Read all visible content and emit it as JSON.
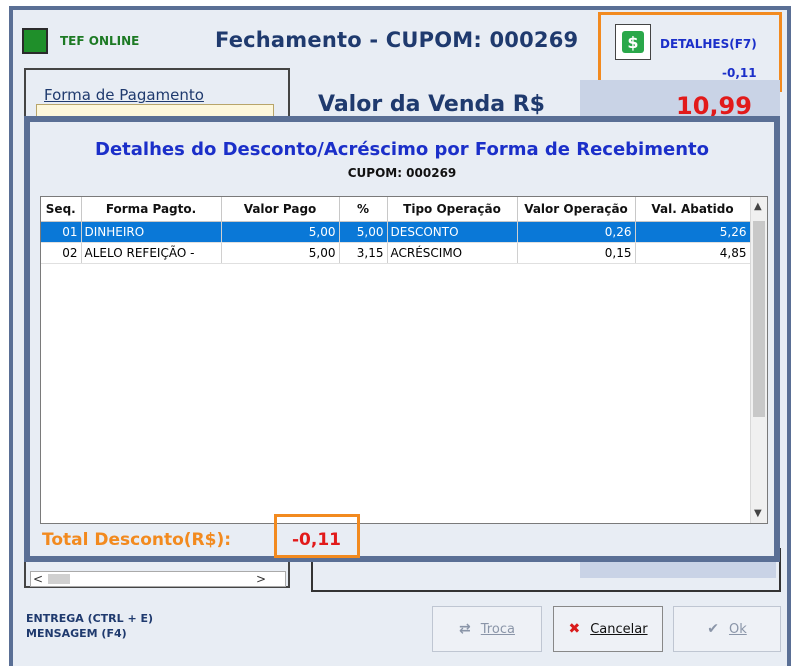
{
  "header": {
    "tef_label": "TEF ONLINE",
    "title": "Fechamento - CUPOM: 000269",
    "detalhes_label": "DETALHES(F7)",
    "detalhes_value": "-0,11",
    "dollar_icon": "dollar-icon",
    "highlight_color": "#f28a1f"
  },
  "left_panel": {
    "forma_pagamento_label": "Forma de Pagamento",
    "scroll_left": "<",
    "scroll_right": ">"
  },
  "venda": {
    "label": "Valor da Venda R$",
    "value": "10,99"
  },
  "dialog": {
    "title": "Detalhes do Desconto/Acréscimo por Forma de Recebimento",
    "subtitle": "CUPOM: 000269",
    "columns": [
      "Seq.",
      "Forma Pagto.",
      "Valor Pago",
      "%",
      "Tipo Operação",
      "Valor Operação",
      "Val. Abatido"
    ],
    "rows": [
      {
        "seq": "01",
        "forma": "DINHEIRO",
        "valor_pago": "5,00",
        "pct": "5,00",
        "tipo": "DESCONTO",
        "valor_op": "0,26",
        "abatido": "5,26"
      },
      {
        "seq": "02",
        "forma": "ALELO REFEIÇÃO -",
        "valor_pago": "5,00",
        "pct": "3,15",
        "tipo": "ACRÉSCIMO",
        "valor_op": "0,15",
        "abatido": "4,85"
      }
    ],
    "total_label": "Total Desconto(R$):",
    "total_value": "-0,11"
  },
  "shortcuts": {
    "entrega": "ENTREGA (CTRL + E)",
    "mensagem": "MENSAGEM (F4)"
  },
  "buttons": {
    "troca": "Troca",
    "cancelar": "Cancelar",
    "ok": "Ok"
  }
}
